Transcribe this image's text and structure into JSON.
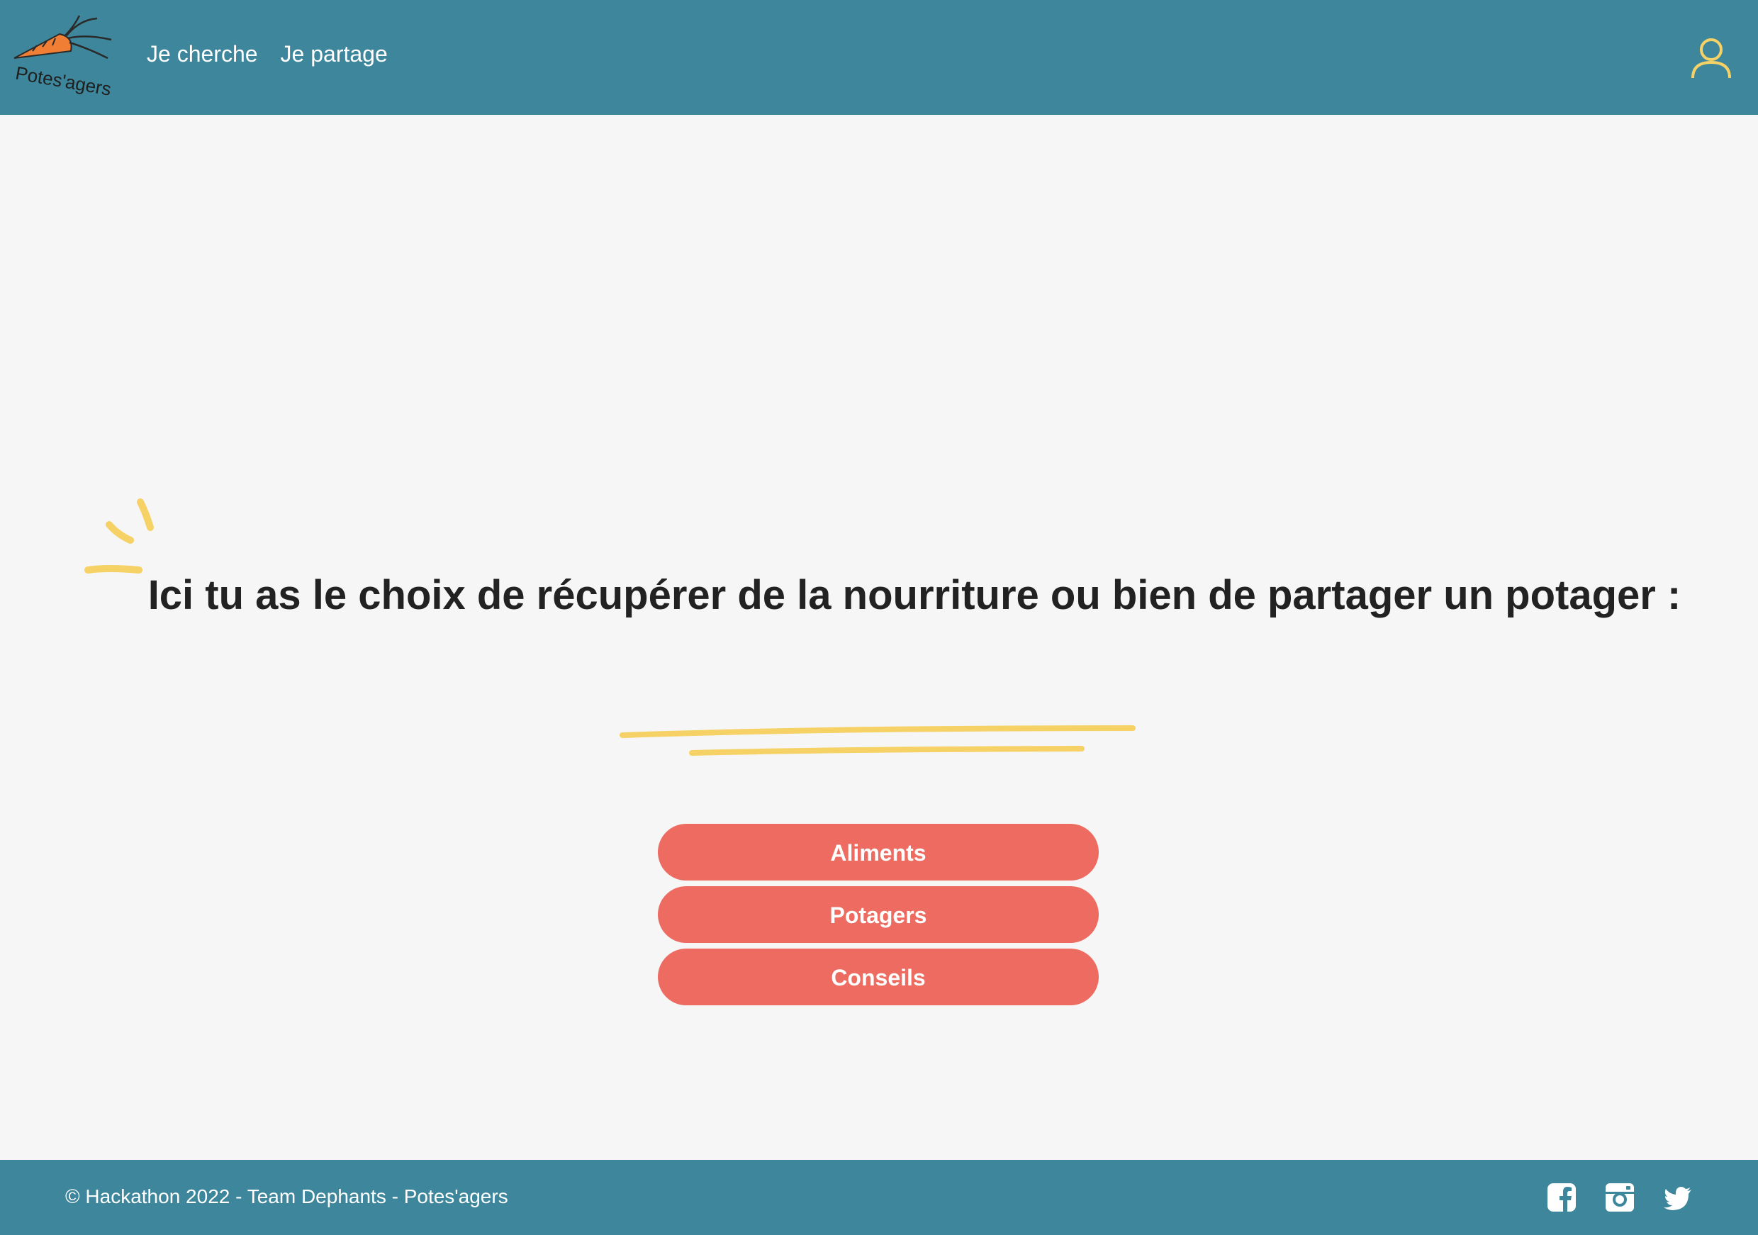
{
  "header": {
    "logo_text": "Potes'agers",
    "nav": [
      {
        "label": "Je cherche"
      },
      {
        "label": "Je partage"
      }
    ],
    "user_icon": "user-profile-icon"
  },
  "main": {
    "headline": "Ici tu as le choix de récupérer de la nourriture ou bien de partager un potager :",
    "buttons": [
      {
        "label": "Aliments"
      },
      {
        "label": "Potagers"
      },
      {
        "label": "Conseils"
      }
    ]
  },
  "footer": {
    "copyright": "© Hackathon 2022 - Team Dephants - Potes'agers",
    "socials": [
      "facebook-icon",
      "instagram-icon",
      "twitter-icon"
    ]
  },
  "colors": {
    "header_bg": "#3d869b",
    "button_bg": "#ed6b61",
    "accent_yellow": "#f5d166",
    "carrot_orange": "#f07f35",
    "page_bg": "#f6f6f6"
  }
}
